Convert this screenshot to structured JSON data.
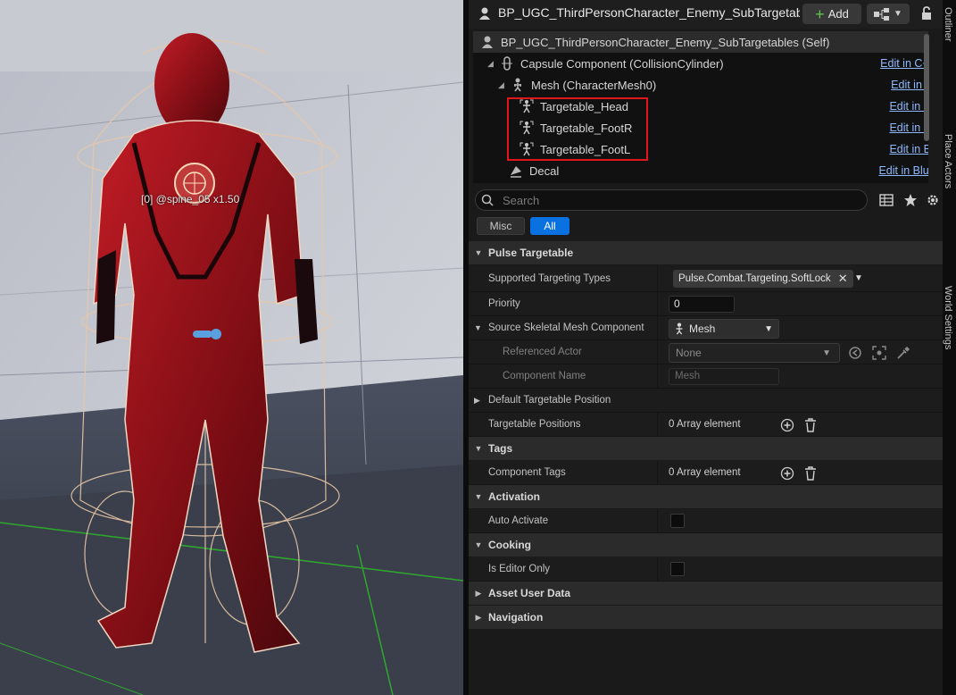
{
  "viewport": {
    "bone_label": "[0] @spine_05 x1.50"
  },
  "panel": {
    "title": "BP_UGC_ThirdPersonCharacter_Enemy_SubTargetables",
    "add_label": "Add",
    "tree": [
      {
        "label": "BP_UGC_ThirdPersonCharacter_Enemy_SubTargetables (Self)",
        "edit": "",
        "icon": "actor-icon"
      },
      {
        "label": "Capsule Component (CollisionCylinder)",
        "edit": "Edit in C++",
        "icon": "capsule-icon"
      },
      {
        "label": "Mesh (CharacterMesh0)",
        "edit": "Edit in C++",
        "icon": "skeletal-mesh-icon"
      },
      {
        "label": "Targetable_Head",
        "edit": "Edit in Blueprint",
        "icon": "targetable-icon"
      },
      {
        "label": "Targetable_FootR",
        "edit": "Edit in Blueprint",
        "icon": "targetable-icon"
      },
      {
        "label": "Targetable_FootL",
        "edit": "Edit in Blueprint",
        "icon": "targetable-icon"
      },
      {
        "label": "Decal",
        "edit": "Edit in Blueprint",
        "icon": "decal-icon"
      }
    ],
    "search_placeholder": "Search",
    "filters": {
      "misc": "Misc",
      "all": "All"
    },
    "categories": {
      "pulse_targetable": "Pulse Targetable",
      "tags": "Tags",
      "activation": "Activation",
      "cooking": "Cooking",
      "asset_user_data": "Asset User Data",
      "navigation": "Navigation"
    },
    "props": {
      "supported_targeting_types": {
        "name": "Supported Targeting Types",
        "value": "Pulse.Combat.Targeting.SoftLock"
      },
      "priority": {
        "name": "Priority",
        "value": "0"
      },
      "source_mesh": {
        "name": "Source Skeletal Mesh Component",
        "value": "Mesh"
      },
      "referenced_actor": {
        "name": "Referenced Actor",
        "value": "None"
      },
      "component_name": {
        "name": "Component Name",
        "value": "Mesh"
      },
      "default_position": {
        "name": "Default Targetable Position"
      },
      "targetable_positions": {
        "name": "Targetable Positions",
        "value": "0 Array element"
      },
      "component_tags": {
        "name": "Component Tags",
        "value": "0 Array element"
      },
      "auto_activate": {
        "name": "Auto Activate"
      },
      "is_editor_only": {
        "name": "Is Editor Only"
      }
    }
  },
  "side_tabs": {
    "outliner": "Outliner",
    "place_actors": "Place Actors",
    "world_settings": "World Settings"
  },
  "colors": {
    "accent": "#0a72e0",
    "highlight": "#e0161a",
    "link": "#8fb9ff"
  }
}
